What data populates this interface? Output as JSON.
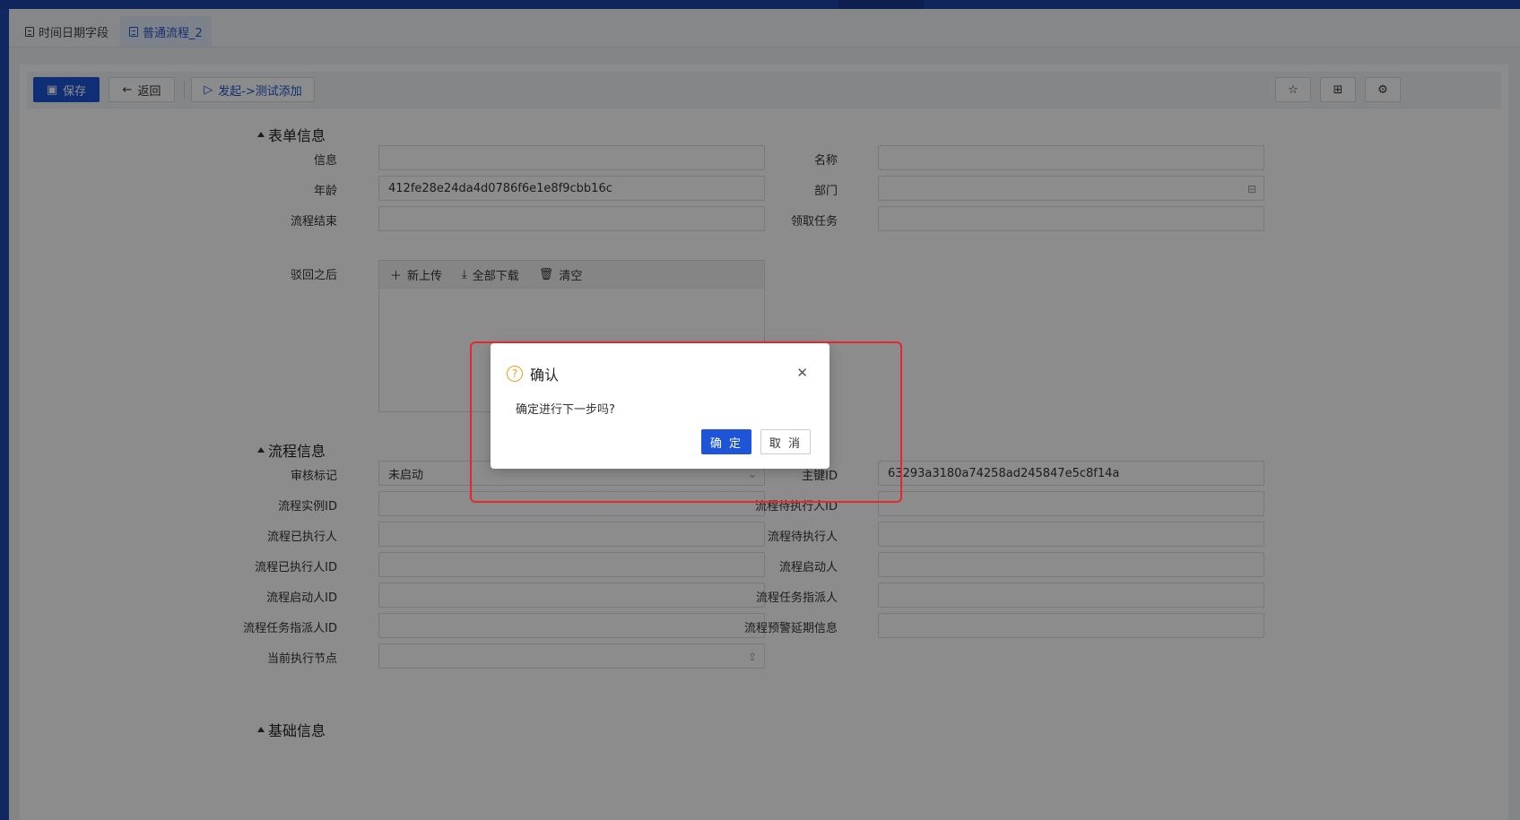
{
  "tabs": [
    {
      "label": "时间日期字段"
    },
    {
      "label": "普通流程_2"
    }
  ],
  "toolbar": {
    "save": "保存",
    "back": "返回",
    "start": "发起->测试添加"
  },
  "form": {
    "section1": "表单信息",
    "fields_left": [
      {
        "label": "信息",
        "value": ""
      },
      {
        "label": "年龄",
        "value": "412fe28e24da4d0786f6e1e8f9cbb16c"
      },
      {
        "label": "流程结束",
        "value": ""
      },
      {
        "label": "驳回之后",
        "value": ""
      }
    ],
    "fields_right": [
      {
        "label": "名称",
        "value": ""
      },
      {
        "label": "部门",
        "value": ""
      },
      {
        "label": "领取任务",
        "value": ""
      }
    ],
    "upload": {
      "add": "新上传",
      "download": "全部下载",
      "clear": "清空"
    },
    "section2": "流程信息",
    "flow_left": [
      {
        "label": "审核标记",
        "value": "未启动"
      },
      {
        "label": "流程实例ID",
        "value": ""
      },
      {
        "label": "流程已执行人",
        "value": ""
      },
      {
        "label": "流程已执行人ID",
        "value": ""
      },
      {
        "label": "流程启动人ID",
        "value": ""
      },
      {
        "label": "流程任务指派人ID",
        "value": ""
      },
      {
        "label": "当前执行节点",
        "value": ""
      }
    ],
    "flow_right": [
      {
        "label": "主键ID",
        "value": "63293a3180a74258ad245847e5c8f14a"
      },
      {
        "label": "流程待执行人ID",
        "value": ""
      },
      {
        "label": "流程待执行人",
        "value": ""
      },
      {
        "label": "流程启动人",
        "value": ""
      },
      {
        "label": "流程任务指派人",
        "value": ""
      },
      {
        "label": "流程预警延期信息",
        "value": ""
      }
    ],
    "section3": "基础信息"
  },
  "dialog": {
    "title": "确认",
    "message": "确定进行下一步吗?",
    "ok": "确 定",
    "cancel": "取 消"
  },
  "colors": {
    "primary": "#1d55d6",
    "warning": "#f0a020",
    "highlight": "#e8262e"
  }
}
